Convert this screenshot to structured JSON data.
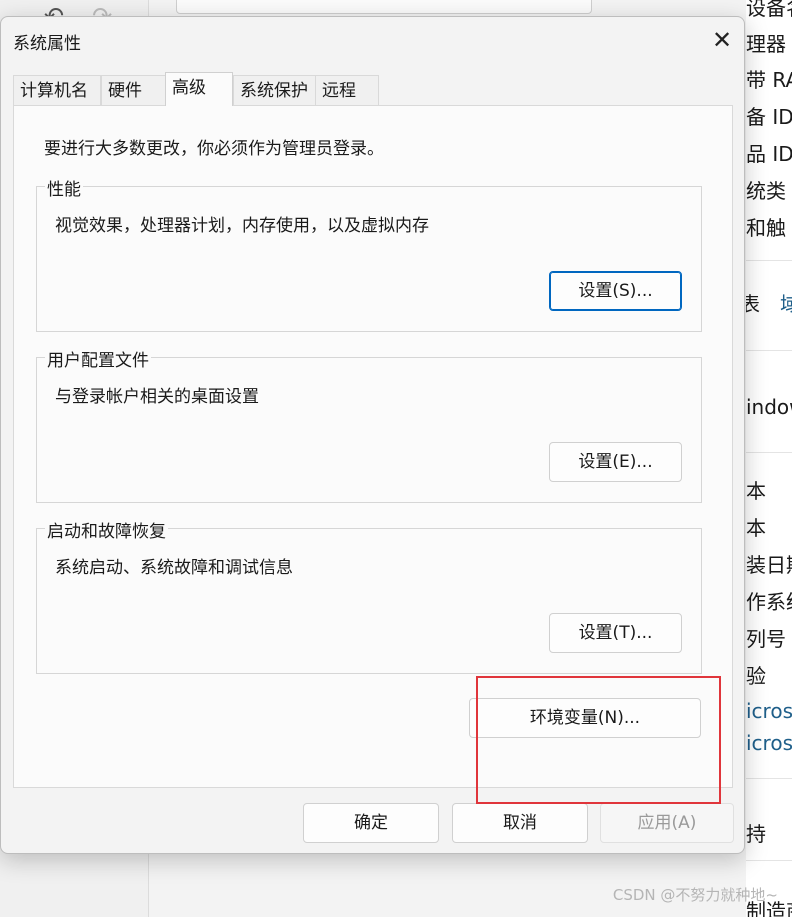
{
  "background": {
    "right_partial_texts": [
      "设备名",
      "理器",
      "带 RA",
      "备 ID",
      "品 ID",
      "统类",
      "和触",
      "表",
      "域",
      "indow",
      "本",
      "本",
      "装日期",
      "作系统",
      "列号",
      "验",
      "icros",
      "icros",
      "持",
      "制造商"
    ]
  },
  "dialog": {
    "title": "系统属性",
    "tabs": [
      {
        "label": "计算机名"
      },
      {
        "label": "硬件"
      },
      {
        "label": "高级"
      },
      {
        "label": "系统保护"
      },
      {
        "label": "远程"
      }
    ],
    "active_tab": "高级",
    "notice": "要进行大多数更改，你必须作为管理员登录。",
    "groups": {
      "performance": {
        "title": "性能",
        "description": "视觉效果，处理器计划，内存使用，以及虚拟内存",
        "button": "设置(S)..."
      },
      "user_profile": {
        "title": "用户配置文件",
        "description": "与登录帐户相关的桌面设置",
        "button": "设置(E)..."
      },
      "startup_recovery": {
        "title": "启动和故障恢复",
        "description": "系统启动、系统故障和调试信息",
        "button": "设置(T)..."
      }
    },
    "env_button": "环境变量(N)...",
    "footer": {
      "ok": "确定",
      "cancel": "取消",
      "apply": "应用(A)"
    }
  },
  "watermark": "CSDN @不努力就种地~",
  "colors": {
    "highlight_box": "#e0353b",
    "primary_border": "#0067c0"
  }
}
